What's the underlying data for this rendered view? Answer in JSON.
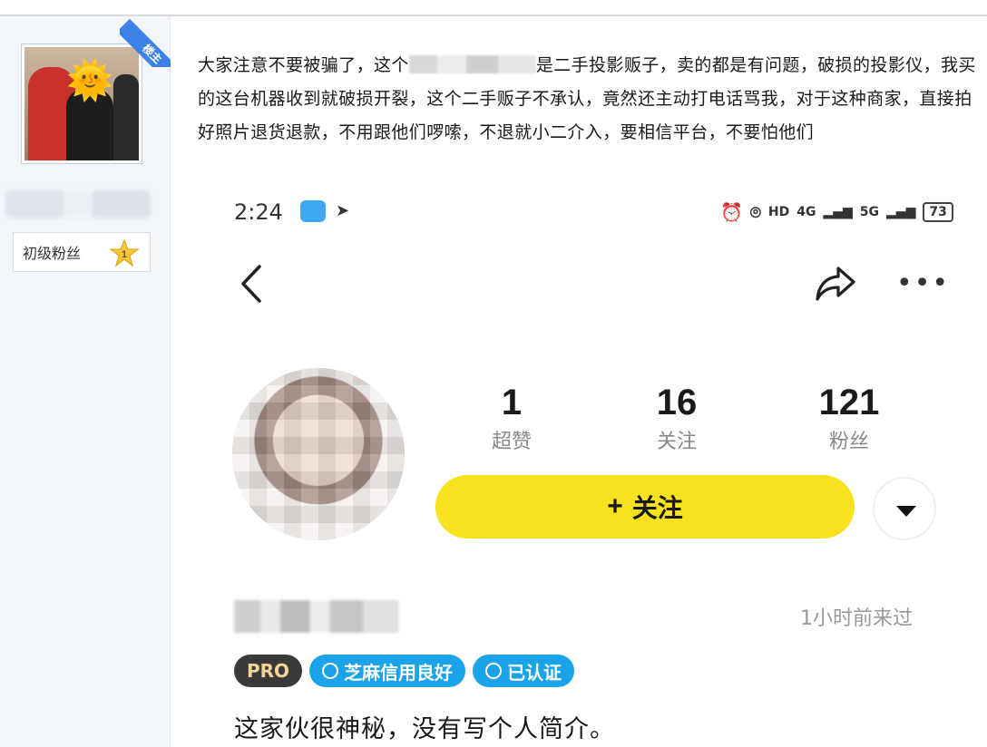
{
  "sidebar": {
    "owner_badge": "楼主",
    "fan_level_label": "初级粉丝",
    "fan_level_number": "1"
  },
  "post": {
    "text_before_redaction": "大家注意不要被骗了，这个",
    "text_after_redaction": "是二手投影贩子，卖的都是有问题，破损的投影仪，我买的这台机器收到就破损开裂，这个二手贩子不承认，竟然还主动打电话骂我，对于这种商家，直接拍好照片退货退款，不用跟他们啰嗦，不退就小二介入，要相信平台，不要怕他们"
  },
  "screenshot": {
    "status_bar": {
      "time": "2:24",
      "network_1": "4G",
      "network_2": "5G",
      "hd_label": "HD",
      "battery": "73"
    },
    "stats": [
      {
        "value": "1",
        "label": "超赞"
      },
      {
        "value": "16",
        "label": "关注"
      },
      {
        "value": "121",
        "label": "粉丝"
      }
    ],
    "follow_button": {
      "plus": "+",
      "label": "关注"
    },
    "last_seen": "1小时前来过",
    "tags": {
      "pro": "PRO",
      "credit": "芝麻信用良好",
      "verified": "已认证"
    },
    "bio": "这家伙很神秘，没有写个人简介。"
  },
  "colors": {
    "follow_yellow": "#f8e11d",
    "tag_blue": "#1aa3e8",
    "owner_ribbon": "#3c82e6"
  }
}
